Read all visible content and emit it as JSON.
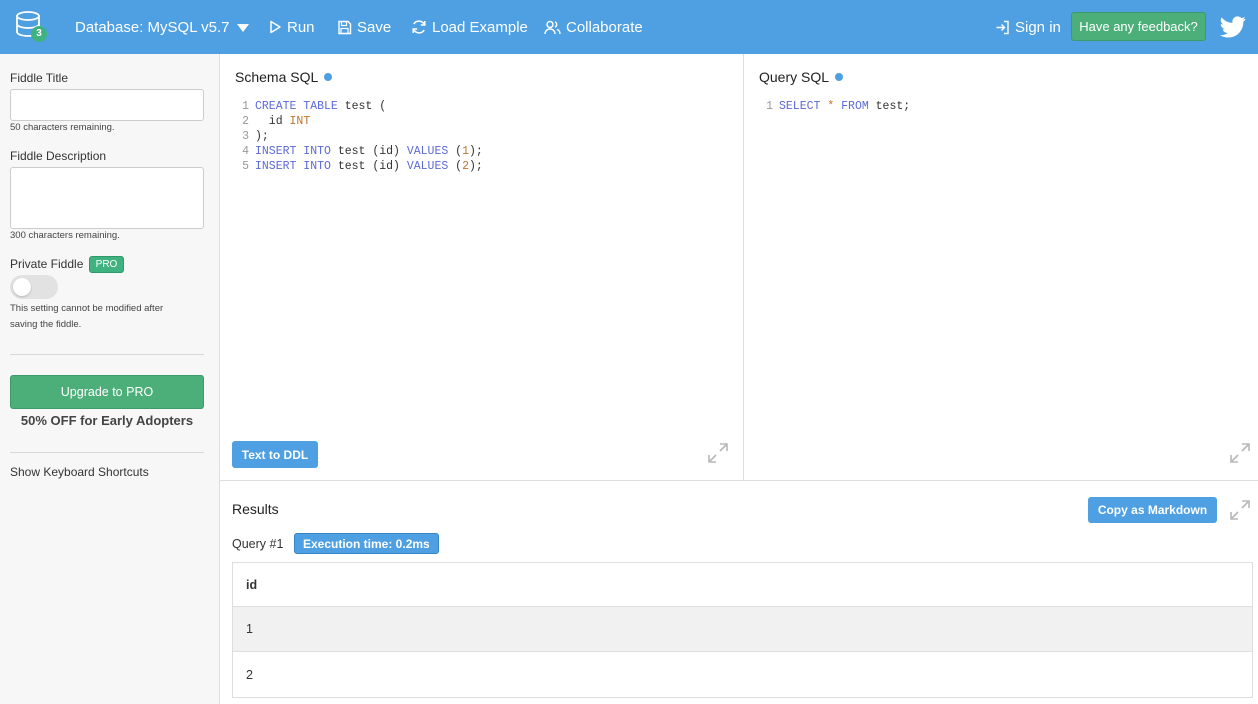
{
  "topbar": {
    "db_badge": "3",
    "database_label": "Database: MySQL v5.7",
    "run_label": "Run",
    "save_label": "Save",
    "load_example_label": "Load Example",
    "collaborate_label": "Collaborate",
    "sign_in_label": "Sign in",
    "feedback_label": "Have any feedback?"
  },
  "sidebar": {
    "title_label": "Fiddle Title",
    "title_value": "",
    "title_hint": "50 characters remaining.",
    "description_label": "Fiddle Description",
    "description_value": "",
    "description_hint": "300 characters remaining.",
    "private_label": "Private Fiddle",
    "pro_badge": "PRO",
    "private_hint_line1": "This setting cannot be modified after",
    "private_hint_line2": "saving the fiddle.",
    "private_enabled": false,
    "upgrade_label": "Upgrade to PRO",
    "promo_label": "50% OFF for Early Adopters",
    "shortcuts_label": "Show Keyboard Shortcuts"
  },
  "schema": {
    "title": "Schema SQL",
    "lines": [
      {
        "n": "1",
        "parts": [
          [
            "kw",
            "CREATE TABLE"
          ],
          [
            "t",
            " test ("
          ]
        ]
      },
      {
        "n": "2",
        "parts": [
          [
            "t",
            "  id "
          ],
          [
            "num",
            "INT"
          ]
        ]
      },
      {
        "n": "3",
        "parts": [
          [
            "t",
            ");"
          ]
        ]
      },
      {
        "n": "4",
        "parts": [
          [
            "kw",
            "INSERT INTO"
          ],
          [
            "t",
            " test (id) "
          ],
          [
            "kw",
            "VALUES"
          ],
          [
            "t",
            " ("
          ],
          [
            "num",
            "1"
          ],
          [
            "t",
            ");"
          ]
        ]
      },
      {
        "n": "5",
        "parts": [
          [
            "kw",
            "INSERT INTO"
          ],
          [
            "t",
            " test (id) "
          ],
          [
            "kw",
            "VALUES"
          ],
          [
            "t",
            " ("
          ],
          [
            "num",
            "2"
          ],
          [
            "t",
            ");"
          ]
        ]
      }
    ],
    "ddl_button": "Text to DDL"
  },
  "query": {
    "title": "Query SQL",
    "lines": [
      {
        "n": "1",
        "parts": [
          [
            "kw",
            "SELECT"
          ],
          [
            "t",
            " "
          ],
          [
            "op",
            "*"
          ],
          [
            "t",
            " "
          ],
          [
            "kw",
            "FROM"
          ],
          [
            "t",
            " test;"
          ]
        ]
      }
    ]
  },
  "results": {
    "title": "Results",
    "copy_markdown_label": "Copy as Markdown",
    "query_label": "Query #1",
    "execution_time": "Execution time: 0.2ms",
    "columns": [
      "id"
    ],
    "rows": [
      [
        "1"
      ],
      [
        "2"
      ]
    ]
  },
  "colors": {
    "primary": "#4ea0e2",
    "success": "#4caf7a",
    "keyword": "#5c6ad8",
    "number": "#c0742f"
  }
}
